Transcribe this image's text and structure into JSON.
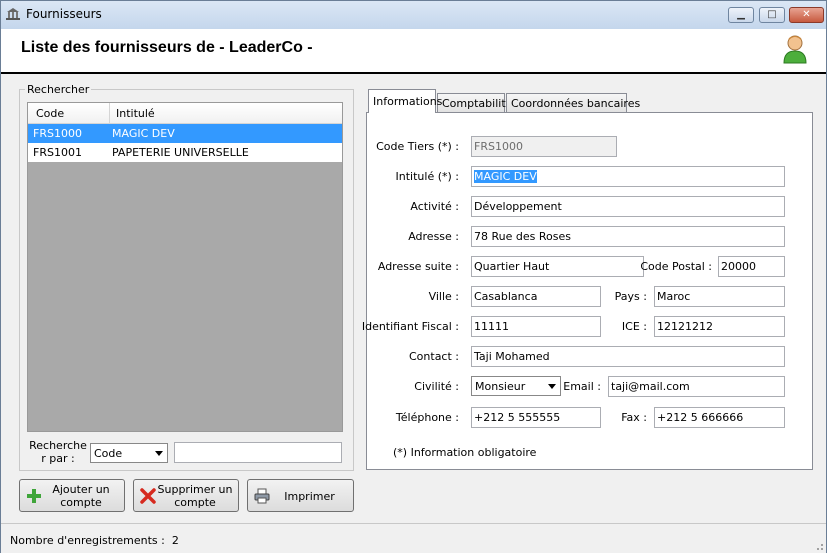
{
  "window": {
    "title": "Fournisseurs",
    "minimize_label": "▁",
    "maximize_label": "□",
    "close_label": "✕"
  },
  "header": {
    "title": "Liste des fournisseurs de - LeaderCo -"
  },
  "search_group": {
    "label": "Rechercher",
    "columns": [
      "Code",
      "Intitulé"
    ],
    "rows": [
      {
        "code": "FRS1000",
        "intitule": "MAGIC DEV",
        "selected": true
      },
      {
        "code": "FRS1001",
        "intitule": "PAPETERIE UNIVERSELLE",
        "selected": false
      }
    ],
    "search_by_label": "Recherche r par :",
    "search_by_value": "Code",
    "search_text": ""
  },
  "buttons": {
    "add_label": "Ajouter un compte",
    "delete_label": "Supprimer un compte",
    "print_label": "Imprimer"
  },
  "tabs": [
    {
      "label": "Informations",
      "active": true
    },
    {
      "label": "Comptabilité",
      "active": false
    },
    {
      "label": "Coordonnées bancaires",
      "active": false
    }
  ],
  "form": {
    "code_tiers": {
      "label": "Code Tiers (*) :",
      "value": "FRS1000"
    },
    "intitule": {
      "label": "Intitulé (*) :",
      "value": "MAGIC DEV"
    },
    "activite": {
      "label": "Activité :",
      "value": "Développement"
    },
    "adresse": {
      "label": "Adresse :",
      "value": "78 Rue des Roses"
    },
    "adresse_suite": {
      "label": "Adresse suite :",
      "value": "Quartier Haut"
    },
    "code_postal": {
      "label": "Code Postal :",
      "value": "20000"
    },
    "ville": {
      "label": "Ville :",
      "value": "Casablanca"
    },
    "pays": {
      "label": "Pays :",
      "value": "Maroc"
    },
    "identifiant_fiscal": {
      "label": "Identifiant Fiscal :",
      "value": "11111"
    },
    "ice": {
      "label": "ICE :",
      "value": "12121212"
    },
    "contact": {
      "label": "Contact :",
      "value": "Taji Mohamed"
    },
    "civilite": {
      "label": "Civilité :",
      "value": "Monsieur"
    },
    "email": {
      "label": "Email :",
      "value": "taji@mail.com"
    },
    "telephone": {
      "label": "Téléphone :",
      "value": "+212 5 555555"
    },
    "fax": {
      "label": "Fax :",
      "value": "+212 5 666666"
    },
    "note": "(*) Information obligatoire"
  },
  "status": {
    "records_label": "Nombre d'enregistrements :",
    "records_count": "2"
  },
  "colors": {
    "selection": "#3399ff",
    "title_bar": "#c4d6ec",
    "close_button": "#c75a3f"
  }
}
